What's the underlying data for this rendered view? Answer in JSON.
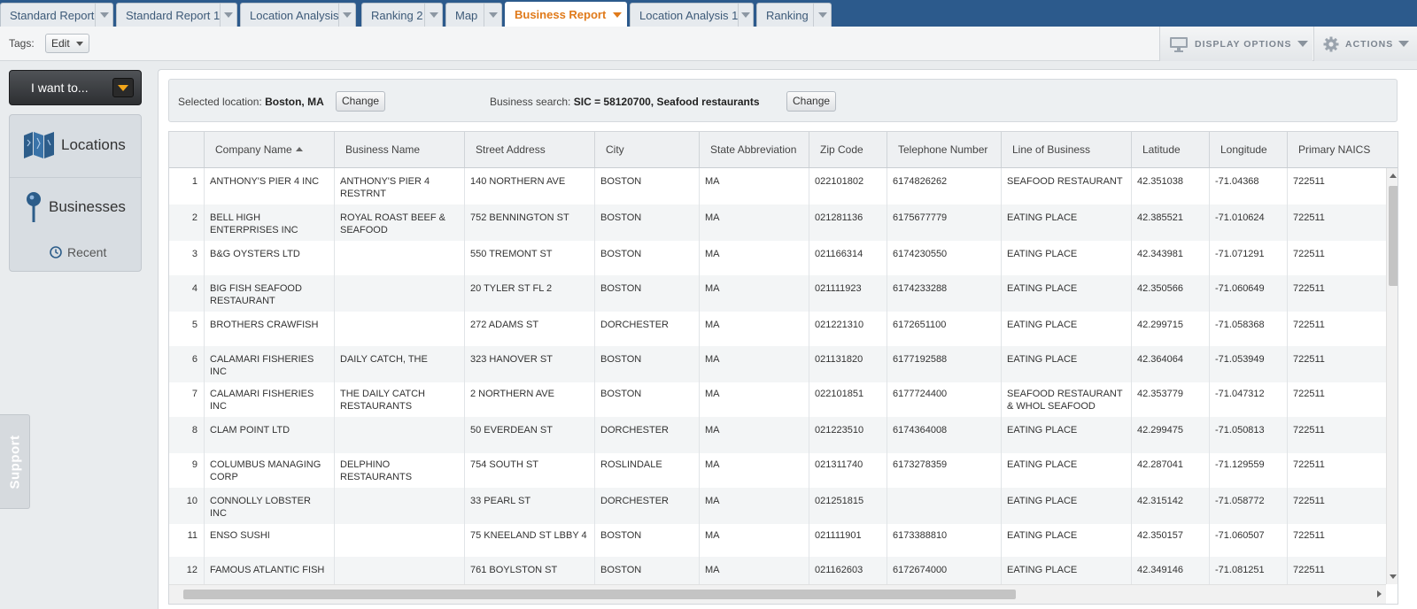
{
  "tabs": [
    {
      "label": "Standard Report",
      "active": false
    },
    {
      "label": "Standard Report 1",
      "active": false
    },
    {
      "label": "Location Analysis",
      "active": false
    },
    {
      "label": "Ranking 2",
      "active": false
    },
    {
      "label": "Map",
      "active": false
    },
    {
      "label": "Business Report",
      "active": true
    },
    {
      "label": "Location Analysis 1",
      "active": false
    },
    {
      "label": "Ranking",
      "active": false
    }
  ],
  "toolbar": {
    "tags_label": "Tags:",
    "tags_edit": "Edit",
    "display_options": "DISPLAY OPTIONS",
    "actions": "ACTIONS"
  },
  "sidebar": {
    "want_label": "I want to...",
    "nav": [
      {
        "label": "Locations",
        "icon": "map-icon"
      },
      {
        "label": "Businesses",
        "icon": "pin-icon"
      }
    ],
    "recent_label": "Recent",
    "support_label": "Support"
  },
  "search": {
    "location_prefix": "Selected location:",
    "location_value": "Boston, MA",
    "location_change": "Change",
    "business_prefix": "Business search:",
    "business_value": "SIC = 58120700, Seafood restaurants",
    "business_change": "Change"
  },
  "table": {
    "columns": [
      "",
      "Company Name",
      "Business Name",
      "Street Address",
      "City",
      "State Abbreviation",
      "Zip Code",
      "Telephone Number",
      "Line of Business",
      "Latitude",
      "Longitude",
      "Primary NAICS"
    ],
    "sorted_column": "Company Name",
    "rows": [
      [
        "1",
        "ANTHONY'S PIER 4 INC",
        "ANTHONY'S PIER 4 RESTRNT",
        "140 NORTHERN AVE",
        "BOSTON",
        "MA",
        "022101802",
        "6174826262",
        "SEAFOOD RESTAURANT",
        "42.351038",
        "-71.04368",
        "722511"
      ],
      [
        "2",
        "BELL HIGH ENTERPRISES INC",
        "ROYAL ROAST BEEF & SEAFOOD",
        "752 BENNINGTON ST",
        "BOSTON",
        "MA",
        "021281136",
        "6175677779",
        "EATING PLACE",
        "42.385521",
        "-71.010624",
        "722511"
      ],
      [
        "3",
        "B&G OYSTERS LTD",
        "",
        "550 TREMONT ST",
        "BOSTON",
        "MA",
        "021166314",
        "6174230550",
        "EATING PLACE",
        "42.343981",
        "-71.071291",
        "722511"
      ],
      [
        "4",
        "BIG FISH SEAFOOD RESTAURANT",
        "",
        "20 TYLER ST FL 2",
        "BOSTON",
        "MA",
        "021111923",
        "6174233288",
        "EATING PLACE",
        "42.350566",
        "-71.060649",
        "722511"
      ],
      [
        "5",
        "BROTHERS CRAWFISH",
        "",
        "272 ADAMS ST",
        "DORCHESTER",
        "MA",
        "021221310",
        "6172651100",
        "EATING PLACE",
        "42.299715",
        "-71.058368",
        "722511"
      ],
      [
        "6",
        "CALAMARI FISHERIES INC",
        "DAILY CATCH, THE",
        "323 HANOVER ST",
        "BOSTON",
        "MA",
        "021131820",
        "6177192588",
        "EATING PLACE",
        "42.364064",
        "-71.053949",
        "722511"
      ],
      [
        "7",
        "CALAMARI FISHERIES INC",
        "THE DAILY CATCH RESTAURANTS",
        "2 NORTHERN AVE",
        "BOSTON",
        "MA",
        "022101851",
        "6177724400",
        "SEAFOOD RESTAURANT & WHOL SEAFOOD",
        "42.353779",
        "-71.047312",
        "722511"
      ],
      [
        "8",
        "CLAM POINT LTD",
        "",
        "50 EVERDEAN ST",
        "DORCHESTER",
        "MA",
        "021223510",
        "6174364008",
        "EATING PLACE",
        "42.299475",
        "-71.050813",
        "722511"
      ],
      [
        "9",
        "COLUMBUS MANAGING CORP",
        "DELPHINO RESTAURANTS",
        "754 SOUTH ST",
        "ROSLINDALE",
        "MA",
        "021311740",
        "6173278359",
        "EATING PLACE",
        "42.287041",
        "-71.129559",
        "722511"
      ],
      [
        "10",
        "CONNOLLY LOBSTER INC",
        "",
        "33 PEARL ST",
        "DORCHESTER",
        "MA",
        "021251815",
        "",
        "EATING PLACE",
        "42.315142",
        "-71.058772",
        "722511"
      ],
      [
        "11",
        "ENSO SUSHI",
        "",
        "75 KNEELAND ST LBBY 4",
        "BOSTON",
        "MA",
        "021111901",
        "6173388810",
        "EATING PLACE",
        "42.350157",
        "-71.060507",
        "722511"
      ],
      [
        "12",
        "FAMOUS ATLANTIC FISH",
        "",
        "761 BOYLSTON ST",
        "BOSTON",
        "MA",
        "021162603",
        "6172674000",
        "EATING PLACE",
        "42.349146",
        "-71.081251",
        "722511"
      ]
    ]
  }
}
